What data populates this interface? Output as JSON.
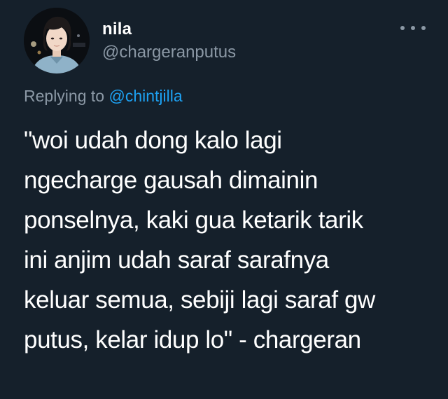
{
  "author": {
    "display_name": "nila",
    "handle": "@chargeranputus"
  },
  "reply": {
    "prefix": "Replying to",
    "mention": "@chintjilla"
  },
  "tweet": {
    "lines": [
      "\"woi udah dong kalo lagi",
      "ngecharge gausah dimainin",
      "ponselnya, kaki gua ketarik tarik",
      "ini anjim udah saraf sarafnya",
      "keluar semua, sebiji lagi saraf gw",
      "putus, kelar idup lo\" - chargeran"
    ]
  },
  "icons": {
    "more": "more-options-icon"
  },
  "colors": {
    "background": "#15202b",
    "text": "#ffffff",
    "secondary_text": "#8b98a5",
    "link": "#1da1f2"
  }
}
